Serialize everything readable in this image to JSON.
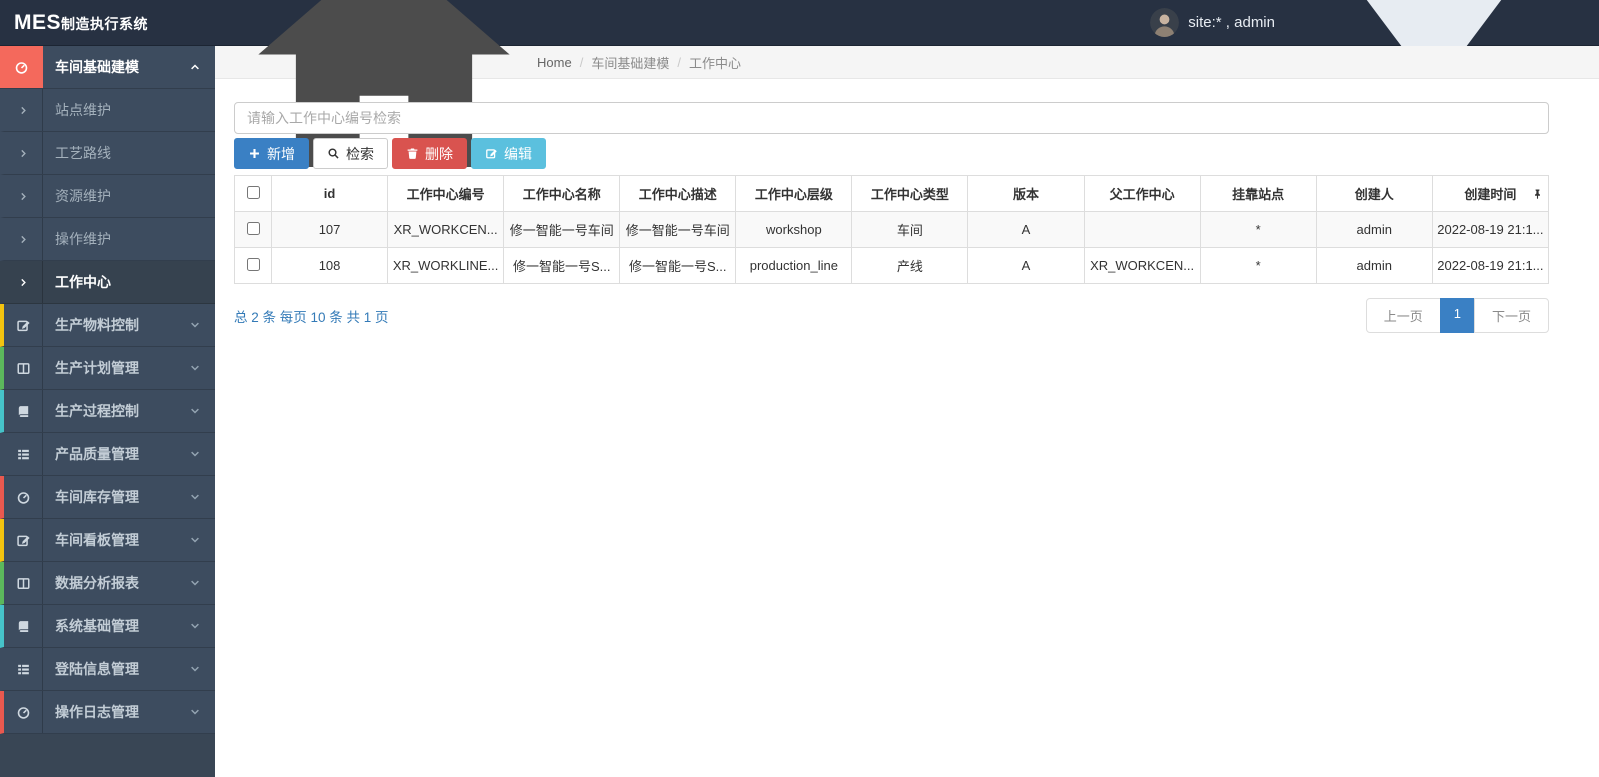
{
  "colors": {
    "primary": "#3a80c4",
    "danger": "#d9534f",
    "info": "#5bc0de",
    "link": "#337ab7",
    "header-bg": "#273142",
    "sidebar-bg": "#394655",
    "item-bg": "#3d4c5f",
    "accent-red": "#f4695c"
  },
  "header": {
    "logo_bold": "MES",
    "logo_suffix": "制造执行系统",
    "user_label": "site:* , admin"
  },
  "breadcrumb": {
    "home": "Home",
    "separator": "/",
    "items": [
      "车间基础建模",
      "工作中心"
    ]
  },
  "sidebar": {
    "items": [
      {
        "id": "workshop-modeling",
        "label": "车间基础建模",
        "icon": "dashboard-icon",
        "expanded": true,
        "stripe": "#f4695c",
        "children": [
          {
            "id": "site-maintenance",
            "label": "站点维护"
          },
          {
            "id": "process-route",
            "label": "工艺路线"
          },
          {
            "id": "resource-maintenance",
            "label": "资源维护"
          },
          {
            "id": "operation-maintenance",
            "label": "操作维护"
          },
          {
            "id": "work-center",
            "label": "工作中心",
            "active": true
          }
        ]
      },
      {
        "id": "production-material-control",
        "label": "生产物料控制",
        "icon": "edit-icon",
        "stripe": "#f3c30f"
      },
      {
        "id": "production-plan-management",
        "label": "生产计划管理",
        "icon": "columns-icon",
        "stripe": "#5cb85c"
      },
      {
        "id": "production-process-control",
        "label": "生产过程控制",
        "icon": "book-icon",
        "stripe": "#46c3c9"
      },
      {
        "id": "product-quality-management",
        "label": "产品质量管理",
        "icon": "list-icon",
        "stripe": "transparent"
      },
      {
        "id": "workshop-inventory-management",
        "label": "车间库存管理",
        "icon": "dashboard-icon",
        "stripe": "#e9594f"
      },
      {
        "id": "workshop-board-management",
        "label": "车间看板管理",
        "icon": "edit-icon",
        "stripe": "#f3c30f"
      },
      {
        "id": "data-analysis-report",
        "label": "数据分析报表",
        "icon": "columns-icon",
        "stripe": "#5cb85c"
      },
      {
        "id": "system-basic-management",
        "label": "系统基础管理",
        "icon": "book-icon",
        "stripe": "#46c3c9"
      },
      {
        "id": "login-info-management",
        "label": "登陆信息管理",
        "icon": "list-icon",
        "stripe": "transparent"
      },
      {
        "id": "operation-log-management",
        "label": "操作日志管理",
        "icon": "dashboard-icon",
        "stripe": "#e9594f"
      }
    ]
  },
  "toolbar": {
    "search_placeholder": "请输入工作中心编号检索",
    "buttons": [
      {
        "id": "add",
        "label": "新增",
        "icon": "plus-icon",
        "style": "primary"
      },
      {
        "id": "search",
        "label": "检索",
        "icon": "search-icon",
        "style": "default"
      },
      {
        "id": "delete",
        "label": "删除",
        "icon": "trash-icon",
        "style": "danger"
      },
      {
        "id": "edit",
        "label": "编辑",
        "icon": "edit-square-icon",
        "style": "info"
      }
    ]
  },
  "table": {
    "columns": [
      "id",
      "工作中心编号",
      "工作中心名称",
      "工作中心描述",
      "工作中心层级",
      "工作中心类型",
      "版本",
      "父工作中心",
      "挂靠站点",
      "创建人",
      "创建时间"
    ],
    "rows": [
      [
        "107",
        "XR_WORKCEN...",
        "修一智能一号车间",
        "修一智能一号车间",
        "workshop",
        "车间",
        "A",
        "",
        "*",
        "admin",
        "2022-08-19 21:1..."
      ],
      [
        "108",
        "XR_WORKLINE...",
        "修一智能一号S...",
        "修一智能一号S...",
        "production_line",
        "产线",
        "A",
        "XR_WORKCEN...",
        "*",
        "admin",
        "2022-08-19 21:1..."
      ]
    ]
  },
  "pagination": {
    "summary": "总 2 条 每页 10 条 共 1 页",
    "prev": "上一页",
    "current": "1",
    "next": "下一页"
  }
}
